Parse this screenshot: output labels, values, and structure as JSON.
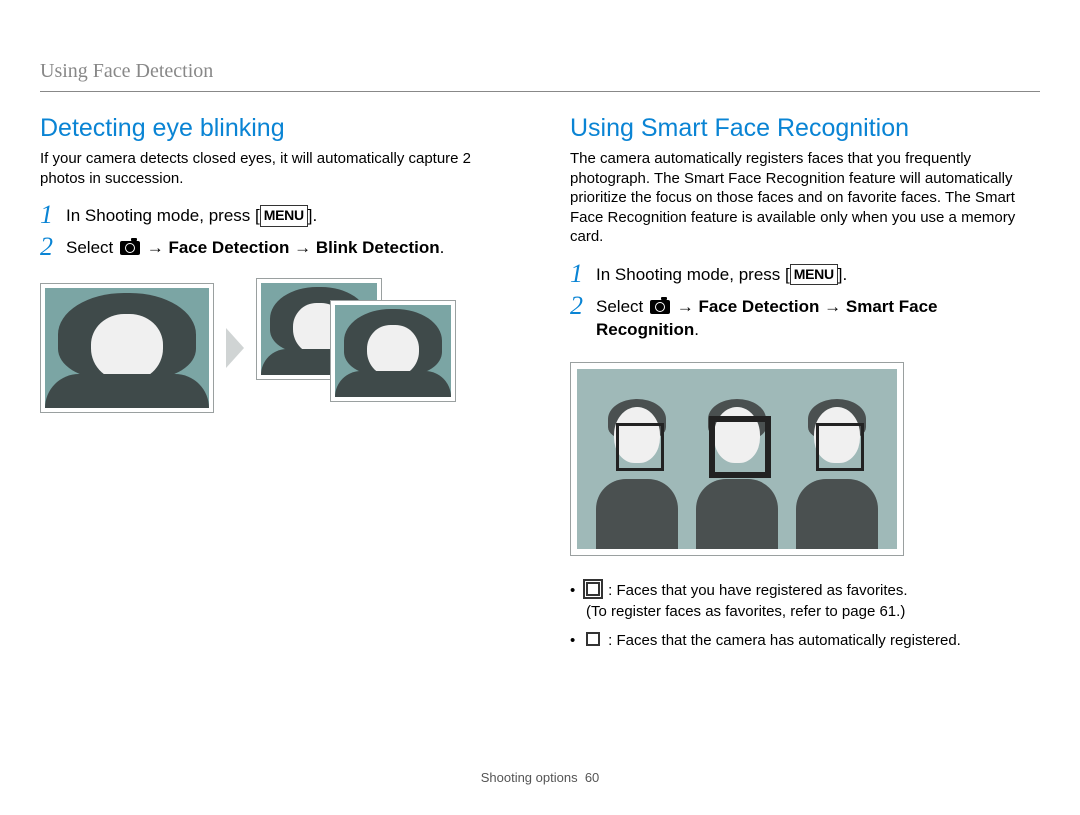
{
  "header": {
    "title": "Using Face Detection"
  },
  "left": {
    "title": "Detecting eye blinking",
    "intro": "If your camera detects closed eyes, it will automatically capture 2 photos in succession.",
    "step1_a": "In Shooting mode, press [",
    "menu": "MENU",
    "step1_b": "].",
    "step2_a": "Select ",
    "step2_b": " → ",
    "step2_fd": "Face Detection",
    "step2_c": " → ",
    "step2_bd": "Blink Detection",
    "step2_d": "."
  },
  "right": {
    "title": "Using Smart Face Recognition",
    "intro": "The camera automatically registers faces that you frequently photograph. The Smart Face Recognition feature will automatically prioritize the focus on those faces and on favorite faces. The Smart Face Recognition feature is available only when you use a memory card.",
    "step1_a": "In Shooting mode, press [",
    "menu": "MENU",
    "step1_b": "].",
    "step2_a": "Select ",
    "step2_b": " → ",
    "step2_fd": "Face Detection",
    "step2_c": " → ",
    "step2_sfr": "Smart Face Recognition",
    "step2_d": ".",
    "bullet1_main": ": Faces that you have registered as favorites.",
    "bullet1_sub": "(To register faces as favorites, refer to page 61.)",
    "bullet2": ": Faces that the camera has automatically registered."
  },
  "footer": {
    "section": "Shooting options",
    "page": "60"
  }
}
